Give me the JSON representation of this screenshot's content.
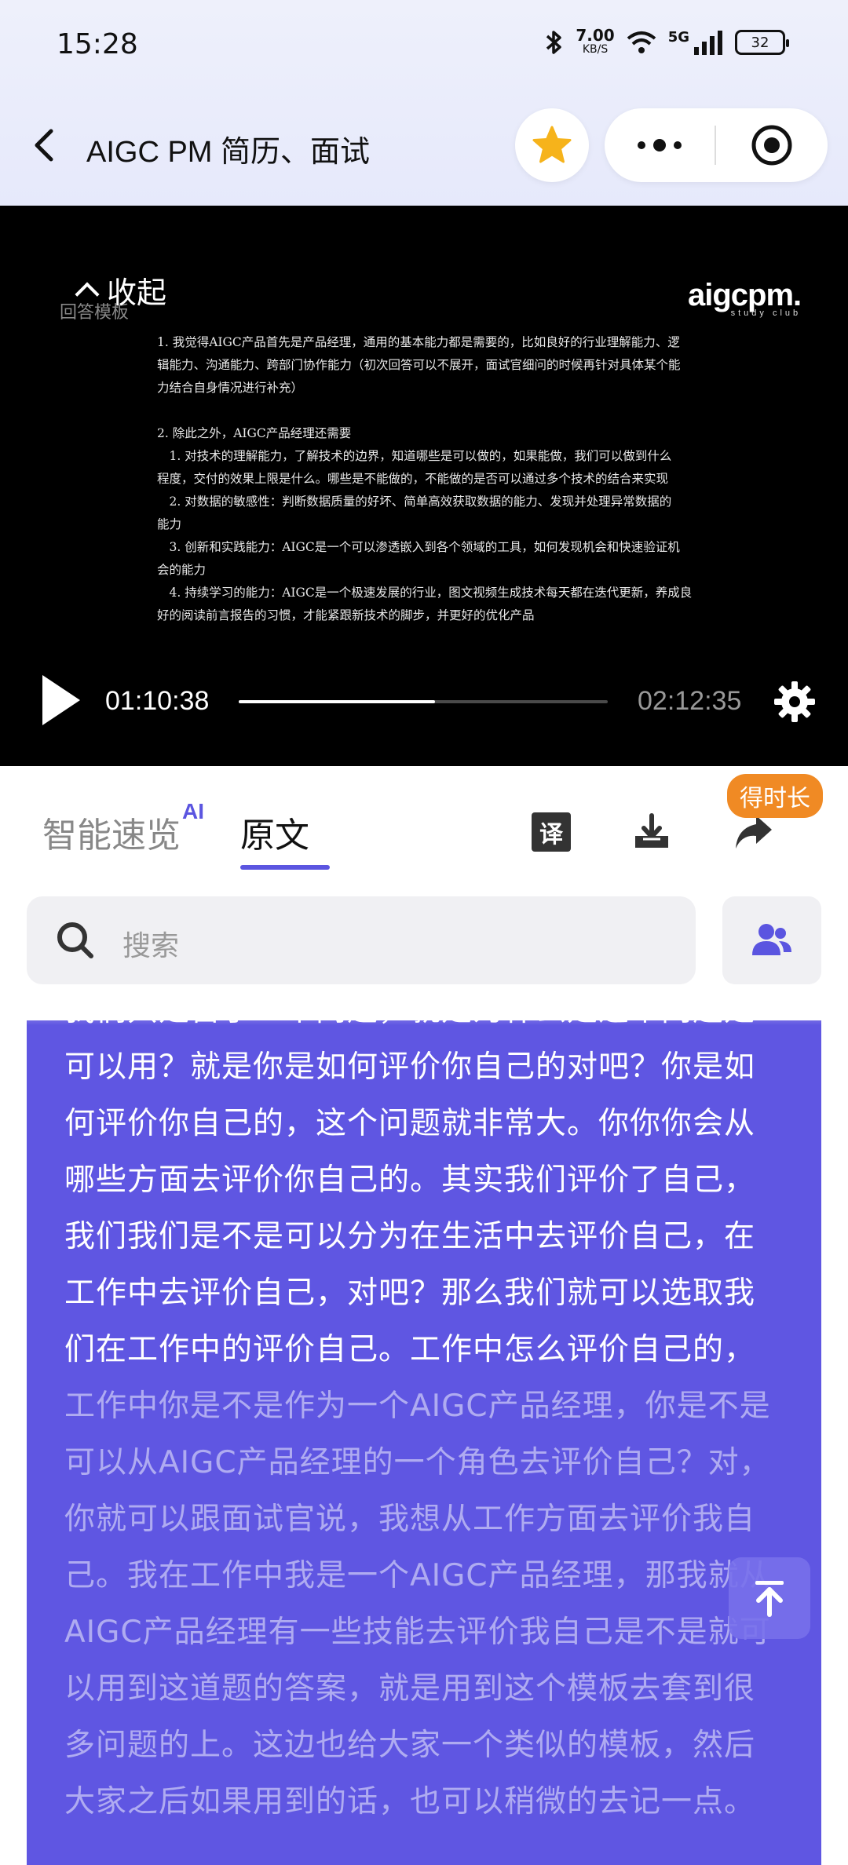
{
  "status_bar": {
    "time": "15:28",
    "net_speed": "7.00",
    "net_unit": "KB/S",
    "signal": "5G",
    "battery": "32"
  },
  "header": {
    "title": "AIGC PM 简历、面试",
    "back_icon": "chevron-left-icon",
    "star_icon": "star-icon",
    "star_color": "#f6b31b"
  },
  "video": {
    "collapse_label": "收起",
    "template_label": "回答模板",
    "brand": "aigcpm.",
    "brand_sub": "study club",
    "slide_lines": [
      "1. 我觉得AIGC产品首先是产品经理，通用的基本能力都是需要的，比如良好的行业理解能力、逻",
      "辑能力、沟通能力、跨部门协作能力（初次回答可以不展开，面试官细问的时候再针对具体某个能",
      "力结合自身情况进行补充）",
      "",
      "2. 除此之外，AIGC产品经理还需要",
      "   1. 对技术的理解能力，了解技术的边界，知道哪些是可以做的，如果能做，我们可以做到什么",
      "程度，交付的效果上限是什么。哪些是不能做的，不能做的是否可以通过多个技术的结合来实现",
      "   2. 对数据的敏感性：判断数据质量的好坏、简单高效获取数据的能力、发现并处理异常数据的",
      "能力",
      "   3. 创新和实践能力：AIGC是一个可以渗透嵌入到各个领域的工具，如何发现机会和快速验证机",
      "会的能力",
      "   4. 持续学习的能力：AIGC是一个极速发展的行业，图文视频生成技术每天都在迭代更新，养成良",
      "好的阅读前言报告的习惯，才能紧跟新技术的脚步，并更好的优化产品"
    ],
    "current_time": "01:10:38",
    "duration": "02:12:35",
    "progress": 0.532
  },
  "tabs": {
    "ai_summary": "智能速览",
    "ai_badge": "AI",
    "original": "原文",
    "translate_label": "译",
    "reward_badge": "得时长",
    "accent": "#5b55e0",
    "badge_color": "#f08a24"
  },
  "search": {
    "placeholder": "搜索"
  },
  "transcript": {
    "read_text": "我们只是留了一个问题，就是为什么是这个问题是可以用？就是你是如何评价你自己的对吧？你是如何评价你自己的，这个问题就非常大。你你你会从哪些方面去评价你自己的。其实我们评价了自己，我们我们是不是可以分为在生活中去评价自己，在工作中去评价自己，对吧？那么我们就可以选取我们在工作中的评价自己。工作中怎么评价自己的，",
    "unread_text": "工作中你是不是作为一个AIGC产品经理，你是不是可以从AIGC产品经理的一个角色去评价自己？对，你就可以跟面试官说，我想从工作方面去评价我自己。我在工作中我是一个AIGC产品经理，那我就从AIGC产品经理有一些技能去评价我自己是不是就可以用到这道题的答案，就是用到这个模板去套到很多问题的上。这边也给大家一个类似的模板，然后大家之后如果用到的话，也可以稍微的去记一点。",
    "card_color": "#5f56e2"
  }
}
